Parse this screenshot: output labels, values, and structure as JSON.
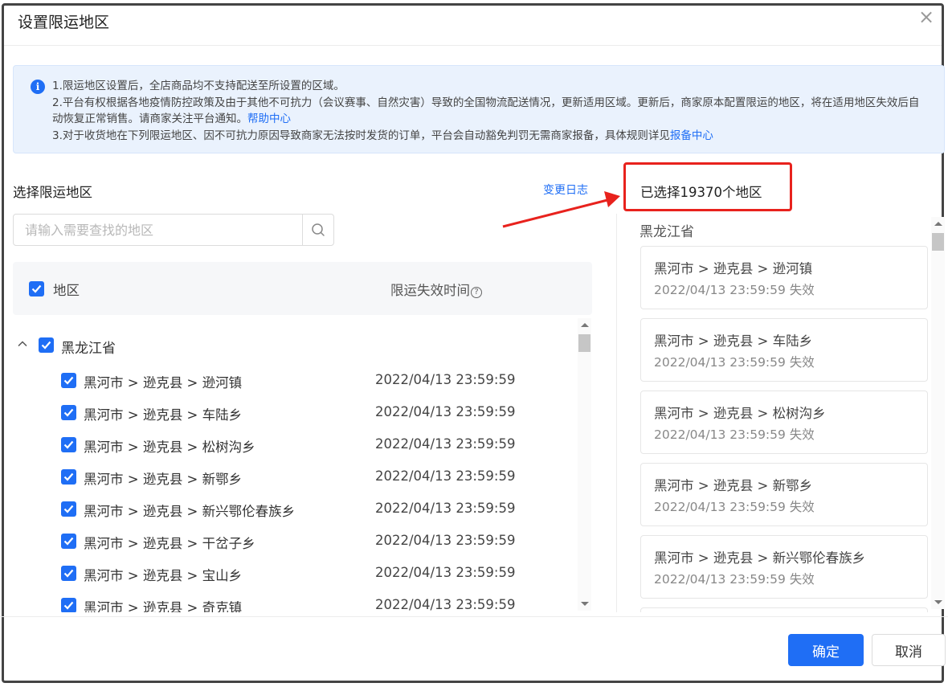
{
  "dialog": {
    "title": "设置限运地区",
    "close_glyph": "×"
  },
  "notice": {
    "icon": "info-icon",
    "line1": "1.限运地区设置后，全店商品均不支持配送至所设置的区域。",
    "line2": "2.平台有权根据各地疫情防控政策及由于其他不可抗力（会议赛事、自然灾害）导致的全国物流配送情况，更新适用区域。更新后，商家原本配置限运的地区，将在适用地区失效后自动恢复正常销售。请商家关注平台通知。",
    "link1": "帮助中心",
    "line3": "3.对于收货地在下列限运地区、因不可抗力原因导致商家无法按时发货的订单，平台会自动豁免判罚无需商家报备，具体规则详见",
    "link2": "报备中心"
  },
  "left": {
    "section_title": "选择限运地区",
    "change_log": "变更日志",
    "search_placeholder": "请输入需要查找的地区",
    "header": {
      "region": "地区",
      "time": "限运失效时间",
      "help_glyph": "?"
    },
    "province": "黑龙江省",
    "rows": [
      {
        "label": "黑河市 > 逊克县 > 逊河镇",
        "time": "2022/04/13 23:59:59"
      },
      {
        "label": "黑河市 > 逊克县 > 车陆乡",
        "time": "2022/04/13 23:59:59"
      },
      {
        "label": "黑河市 > 逊克县 > 松树沟乡",
        "time": "2022/04/13 23:59:59"
      },
      {
        "label": "黑河市 > 逊克县 > 新鄂乡",
        "time": "2022/04/13 23:59:59"
      },
      {
        "label": "黑河市 > 逊克县 > 新兴鄂伦春族乡",
        "time": "2022/04/13 23:59:59"
      },
      {
        "label": "黑河市 > 逊克县 > 干岔子乡",
        "time": "2022/04/13 23:59:59"
      },
      {
        "label": "黑河市 > 逊克县 > 宝山乡",
        "time": "2022/04/13 23:59:59"
      },
      {
        "label": "黑河市 > 逊克县 > 奇克镇",
        "time": "2022/04/13 23:59:59"
      }
    ]
  },
  "right": {
    "selected_count": "已选择19370个地区",
    "province": "黑龙江省",
    "cards": [
      {
        "path": "黑河市 > 逊克县 > 逊河镇",
        "sub": "2022/04/13 23:59:59 失效"
      },
      {
        "path": "黑河市 > 逊克县 > 车陆乡",
        "sub": "2022/04/13 23:59:59 失效"
      },
      {
        "path": "黑河市 > 逊克县 > 松树沟乡",
        "sub": "2022/04/13 23:59:59 失效"
      },
      {
        "path": "黑河市 > 逊克县 > 新鄂乡",
        "sub": "2022/04/13 23:59:59 失效"
      },
      {
        "path": "黑河市 > 逊克县 > 新兴鄂伦春族乡",
        "sub": "2022/04/13 23:59:59 失效"
      }
    ]
  },
  "footer": {
    "ok": "确定",
    "cancel": "取消"
  },
  "colors": {
    "primary": "#1f6ef5",
    "highlight_red": "#e8221d",
    "notice_bg": "#eaf2fd"
  }
}
